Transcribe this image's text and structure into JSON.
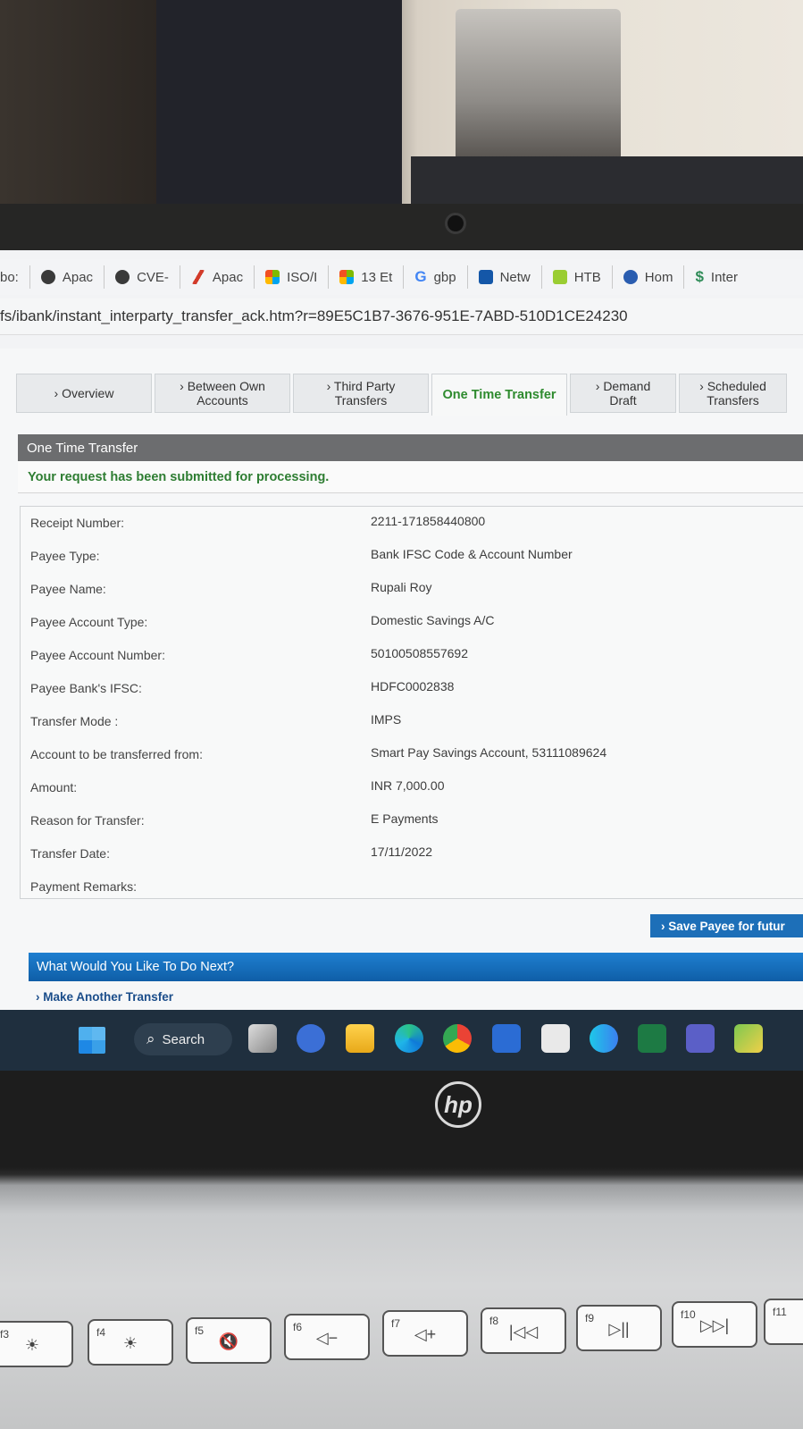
{
  "bookmarks": [
    {
      "label": "bo:",
      "color": "#888888"
    },
    {
      "label": "Apac",
      "color": "#f08a24"
    },
    {
      "label": "CVE-",
      "color": "#f08a24"
    },
    {
      "label": "Apac",
      "color": "#d23b2a"
    },
    {
      "label": "ISO/I",
      "color": "#2f86d6"
    },
    {
      "label": "13 Et",
      "color": "#2f86d6"
    },
    {
      "label": "gbp",
      "color": "#4285f4"
    },
    {
      "label": "Netw",
      "color": "#1457a8"
    },
    {
      "label": "HTB",
      "color": "#9acd32"
    },
    {
      "label": "Hom",
      "color": "#2a5db0"
    },
    {
      "label": "Inter",
      "color": "#2e8b57"
    }
  ],
  "address_bar": {
    "url": "fs/ibank/instant_interparty_transfer_ack.htm?r=89E5C1B7-3676-951E-7ABD-510D1CE24230"
  },
  "tabs": [
    {
      "label": "› Overview"
    },
    {
      "label": "› Between Own Accounts"
    },
    {
      "label": "› Third Party Transfers"
    },
    {
      "label": "One Time Transfer",
      "active": true
    },
    {
      "label": "› Demand Draft"
    },
    {
      "label": "› Scheduled Transfers"
    }
  ],
  "panel": {
    "title": "One Time Transfer",
    "success_message": "Your request has been submitted for processing."
  },
  "details": [
    {
      "label": "Receipt Number:",
      "value": "2211-171858440800"
    },
    {
      "label": "Payee Type:",
      "value": "Bank IFSC Code & Account Number"
    },
    {
      "label": "Payee Name:",
      "value": "Rupali Roy"
    },
    {
      "label": "Payee Account Type:",
      "value": "Domestic Savings A/C"
    },
    {
      "label": "Payee Account Number:",
      "value": "50100508557692"
    },
    {
      "label": "Payee Bank's IFSC:",
      "value": "HDFC0002838"
    },
    {
      "label": "Transfer Mode :",
      "value": "IMPS"
    },
    {
      "label": "Account to be transferred from:",
      "value": "Smart Pay Savings Account, 53111089624"
    },
    {
      "label": "Amount:",
      "value": "INR  7,000.00"
    },
    {
      "label": "Reason for Transfer:",
      "value": "E Payments"
    },
    {
      "label": "Transfer Date:",
      "value": "17/11/2022"
    },
    {
      "label": "Payment Remarks:",
      "value": ""
    }
  ],
  "save_payee_button": "› Save Payee for futur",
  "next_section": {
    "title": "What Would You Like To Do Next?",
    "link": "› Make Another Transfer"
  },
  "taskbar": {
    "search_label": "Search",
    "apps": [
      "windows-start",
      "task-view",
      "teams-meet",
      "file-explorer",
      "edge",
      "chrome",
      "word",
      "snipping-tool",
      "webex",
      "excel",
      "teams",
      "paint"
    ]
  },
  "laptop": {
    "brand": "hp",
    "fn_keys": [
      {
        "fn": "f3",
        "symbol": "☀"
      },
      {
        "fn": "f4",
        "symbol": "☀"
      },
      {
        "fn": "f5",
        "symbol": "🔇"
      },
      {
        "fn": "f6",
        "symbol": "◁−"
      },
      {
        "fn": "f7",
        "symbol": "◁+"
      },
      {
        "fn": "f8",
        "symbol": "|◁◁"
      },
      {
        "fn": "f9",
        "symbol": "▷||"
      },
      {
        "fn": "f10",
        "symbol": "▷▷|"
      },
      {
        "fn": "f11",
        "symbol": ""
      }
    ]
  }
}
